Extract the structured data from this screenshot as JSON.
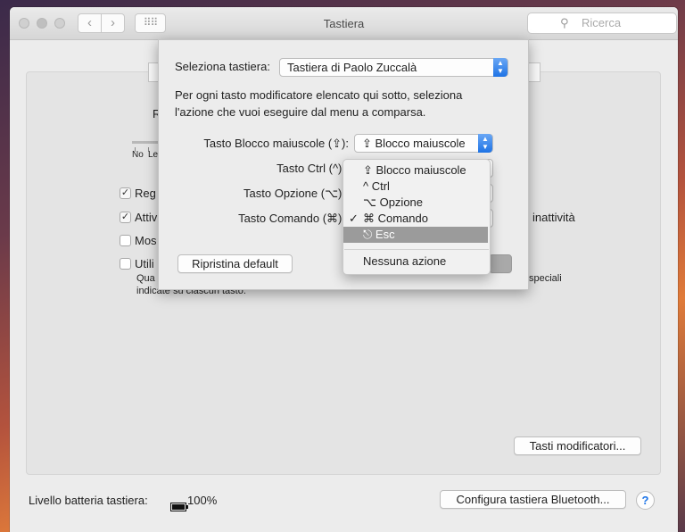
{
  "window": {
    "title": "Tastiera"
  },
  "search": {
    "placeholder": "Ricerca"
  },
  "sheet": {
    "keyboard_label": "Seleziona tastiera:",
    "keyboard_value": "Tastiera di Paolo Zuccalà",
    "description_line1": "Per ogni tasto modificatore elencato qui sotto, seleziona",
    "description_line2": "l'azione che vuoi eseguire dal menu a comparsa.",
    "caps_label": "Tasto Blocco maiuscole (⇪):",
    "caps_value": "⇪ Blocco maiuscole",
    "ctrl_label": "Tasto Ctrl (^):",
    "option_label": "Tasto Opzione (⌥):",
    "command_label": "Tasto Comando (⌘):",
    "restore_button": "Ripristina default"
  },
  "menu": {
    "items": [
      "⇪ Blocco maiuscole",
      "^ Ctrl",
      "⌥ Opzione",
      "⌘ Comando",
      "⎋ Esc"
    ],
    "checked": "✓",
    "separator_item": "Nessuna azione"
  },
  "background": {
    "slider_no": "No",
    "slider_le": "Le",
    "tab_r": "R",
    "cb1": "Reg",
    "cb2": "Attiv",
    "cb2_right": "inattività",
    "cb3": "Mos",
    "cb4": "Utili",
    "cb4_line2_left": "Qua",
    "cb4_line2_right": "speciali",
    "cb4_line3": "indicate su ciascun tasto.",
    "modifier_button": "Tasti modificatori...",
    "battery_label": "Livello batteria tastiera:",
    "battery_value": "100%",
    "bluetooth_button": "Configura tastiera Bluetooth...",
    "help": "?"
  }
}
